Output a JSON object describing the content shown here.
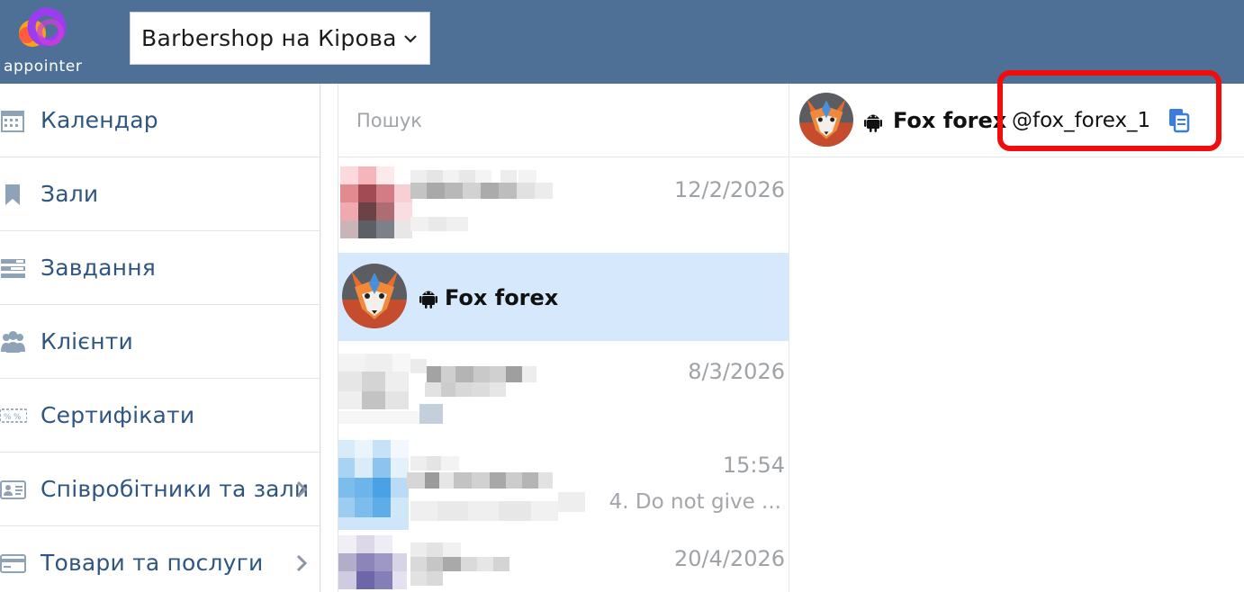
{
  "header": {
    "logo_text": "appointer",
    "branch": "Barbershop на Кірова"
  },
  "sidebar": {
    "items": [
      {
        "label": "Календар",
        "icon": "calendar-icon"
      },
      {
        "label": "Зали",
        "icon": "bookmark-icon"
      },
      {
        "label": "Завдання",
        "icon": "tasks-icon"
      },
      {
        "label": "Клієнти",
        "icon": "users-icon"
      },
      {
        "label": "Сертифікати",
        "icon": "certificate-icon"
      },
      {
        "label": "Співробітники та зали",
        "icon": "id-card-icon"
      },
      {
        "label": "Товари та послуги",
        "icon": "credit-card-icon"
      }
    ]
  },
  "chatlist": {
    "search_placeholder": "Пошук",
    "chats": [
      {
        "date": "12/2/2026"
      },
      {
        "name": "Fox forex"
      },
      {
        "date": "8/3/2026"
      },
      {
        "date": "15:54",
        "preview": "4. Do not give ..."
      },
      {
        "date": "20/4/2026"
      }
    ]
  },
  "conversation": {
    "name": "Fox forex",
    "handle": "@fox_forex_1"
  },
  "colors": {
    "topbar": "#4f7096",
    "nav_text": "#2f5680",
    "selected_row": "#d6e8fb",
    "highlight": "#f20d0d"
  }
}
